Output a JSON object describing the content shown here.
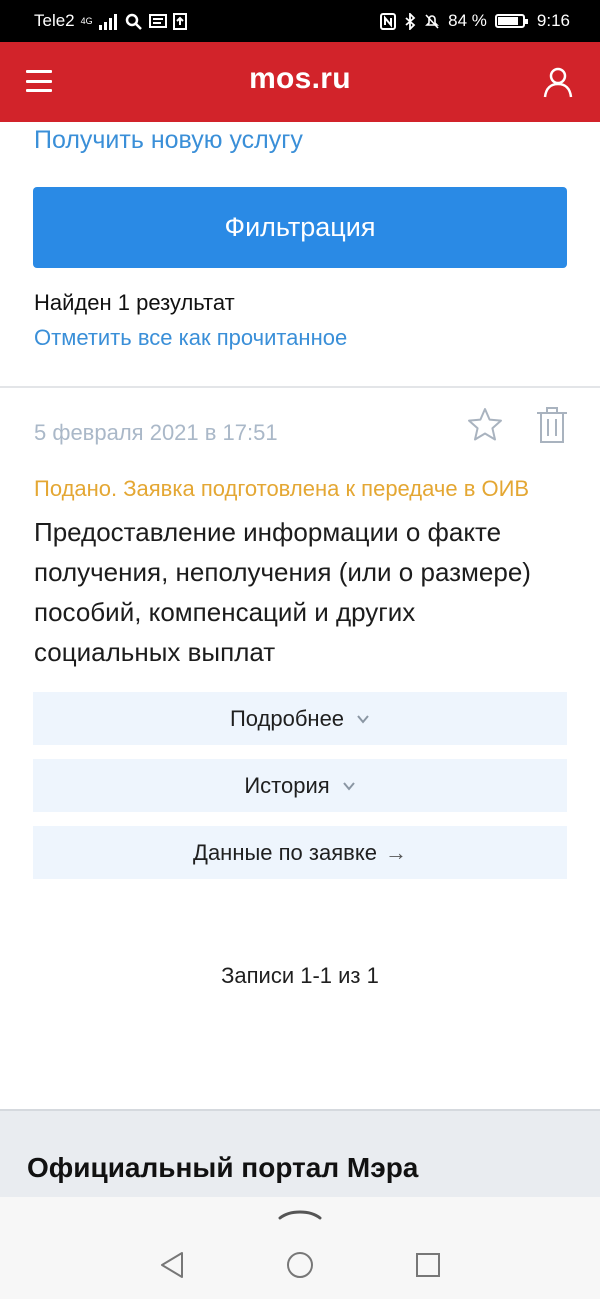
{
  "status_bar": {
    "carrier": "Tele2",
    "network": "4G",
    "battery": "84 %",
    "battery_level": 0.84,
    "time": "9:16"
  },
  "header": {
    "logo": "mos.ru",
    "menu_icon": "hamburger-menu-icon",
    "user_icon": "user-icon",
    "color": "#d2232a"
  },
  "actions": {
    "new_service": "Получить новую услугу",
    "filter_button": "Фильтрация"
  },
  "results": {
    "found": "Найден 1 результат",
    "mark_all_read": "Отметить все как прочитанное"
  },
  "application": {
    "date": "5 февраля 2021 в 17:51",
    "status": "Подано. Заявка подготовлена к передаче в ОИВ",
    "title": "Предоставление информации о факте получения, неполучения (или о размере) пособий, компенсаций и других социальных выплат",
    "details_label": "Подробнее",
    "history_label": "История",
    "data_label": "Данные по заявке",
    "arrow": "→"
  },
  "pagination": {
    "records": "Записи 1-1 из 1"
  },
  "footer": {
    "title": "Официальный портал Мэра"
  },
  "colors": {
    "accent_blue": "#2a8ae5",
    "link_blue": "#3a8fd8",
    "status_orange": "#e4a733",
    "header_red": "#d2232a"
  }
}
